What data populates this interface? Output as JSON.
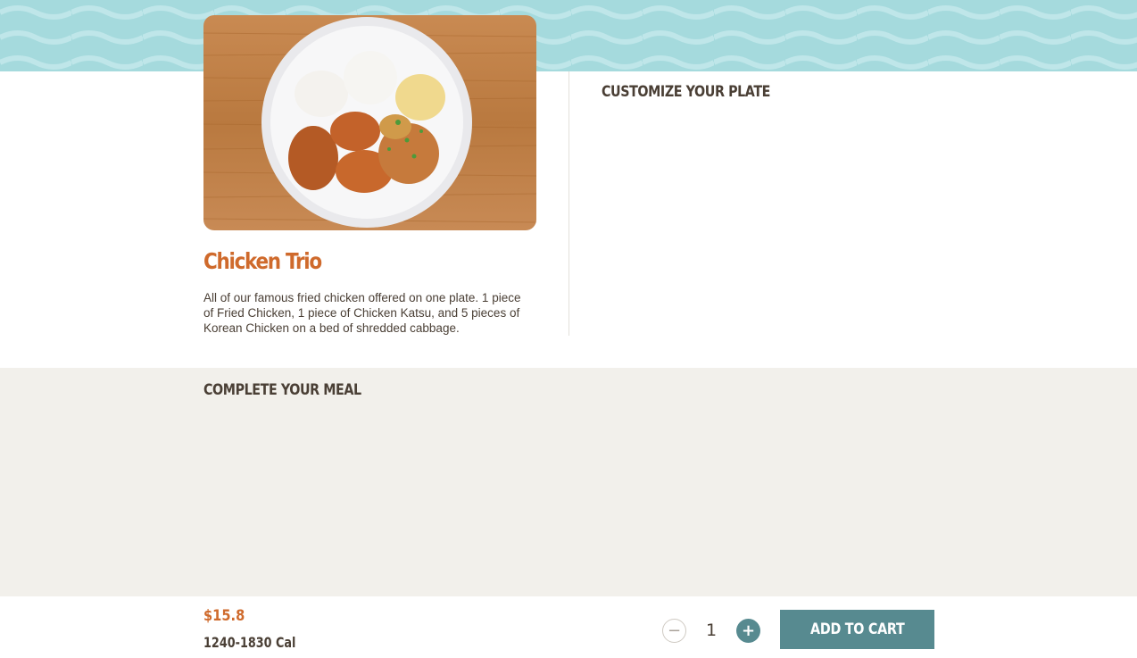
{
  "product": {
    "title": "Chicken Trio",
    "description": "All of our famous fried chicken offered on one plate. 1 piece of Fried Chicken, 1 piece of Chicken Katsu, and 5 pieces of Korean Chicken on a bed of shredded cabbage.",
    "image_icon": "plate-photo"
  },
  "customize": {
    "title": "CUSTOMIZE YOUR PLATE"
  },
  "complete_meal": {
    "title": "COMPLETE YOUR MEAL"
  },
  "footer": {
    "price": "$15.8",
    "calories": "1240-1830 Cal",
    "quantity": "1",
    "minus_label": "−",
    "plus_label": "+",
    "add_to_cart_label": "ADD TO CART"
  },
  "colors": {
    "accent_orange": "#cf6a2c",
    "teal": "#578a90",
    "text_brown": "#4a3f35",
    "banner_blue": "#a8dde1",
    "section_beige": "#f2f0eb"
  }
}
